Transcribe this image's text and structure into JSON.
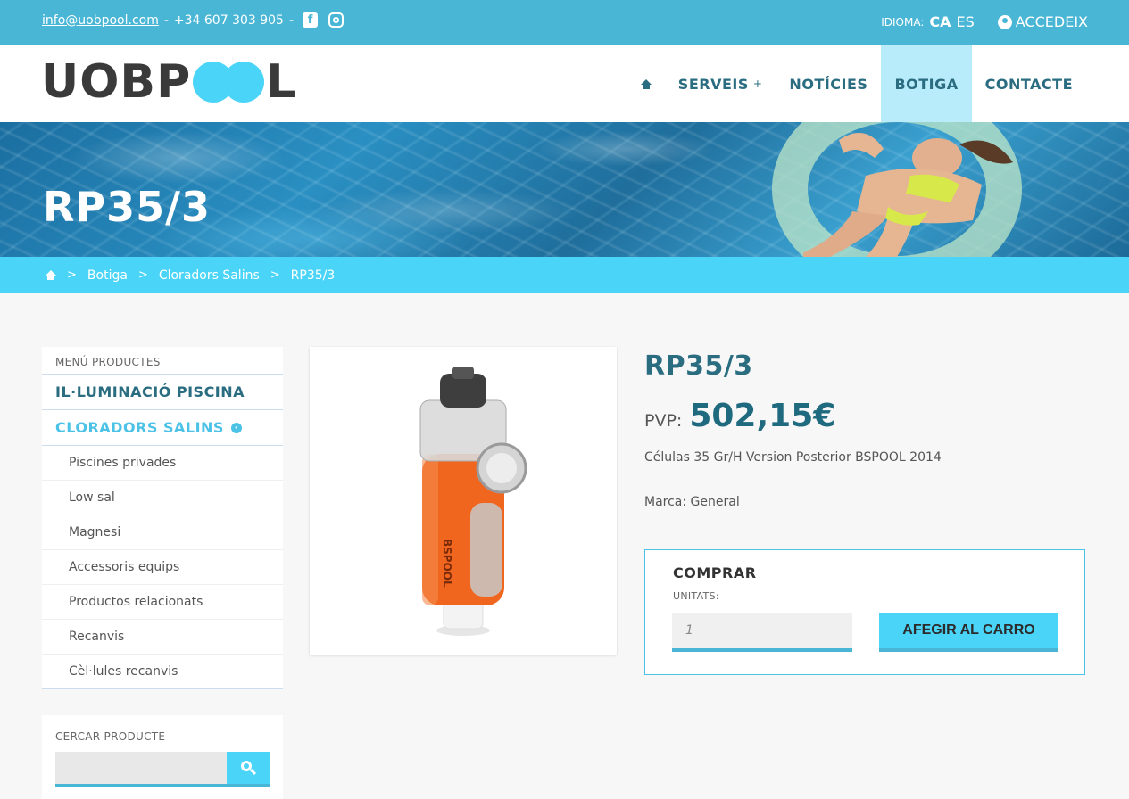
{
  "topbar": {
    "email": "info@uobpool.com",
    "separator1": "-",
    "phone": "+34 607 303 905",
    "separator2": "-",
    "facebook_glyph": "f",
    "language_label": "IDIOMA:",
    "language_current": "CA",
    "language_alt": "ES",
    "login_label": "ACCEDEIX"
  },
  "brand": {
    "logo_left": "UOBP",
    "logo_right": "L",
    "logo_accent": "#4ad4f7"
  },
  "nav": {
    "items": [
      {
        "label": "SERVEIS",
        "suffix": "+"
      },
      {
        "label": "NOTÍCIES"
      },
      {
        "label": "BOTIGA"
      },
      {
        "label": "CONTACTE"
      }
    ]
  },
  "hero": {
    "title": "RP35/3"
  },
  "breadcrumb": {
    "sep": ">",
    "items": [
      "Botiga",
      "Cloradors Salins",
      "RP35/3"
    ]
  },
  "sidebar": {
    "heading": "MENÚ PRODUCTES",
    "categories": [
      {
        "label": "IL·LUMINACIÓ PISCINA"
      },
      {
        "label": "CLORADORS SALINS",
        "chevron": "‹"
      }
    ],
    "subcategories": [
      "Piscines privades",
      "Low sal",
      "Magnesi",
      "Accessoris equips",
      "Productos relacionats",
      "Recanvis",
      "Cèl·lules recanvis"
    ],
    "search_label": "CERCAR PRODUCTE"
  },
  "product": {
    "name": "RP35/3",
    "price_label": "PVP:",
    "price": "502,15€",
    "description": "Células 35 Gr/H Version Posterior BSPOOL 2014",
    "brand_line": "Marca: General",
    "image_text": "BSPOOL"
  },
  "buy": {
    "title": "COMPRAR",
    "units_label": "UNITATS:",
    "quantity": "1",
    "add_button": "AFEGIR AL CARRO"
  },
  "colors": {
    "topbar": "#49b6d5",
    "accent": "#4ad4f7",
    "nav_text": "#2a6c80",
    "nav_active": "#b9ecfa"
  }
}
